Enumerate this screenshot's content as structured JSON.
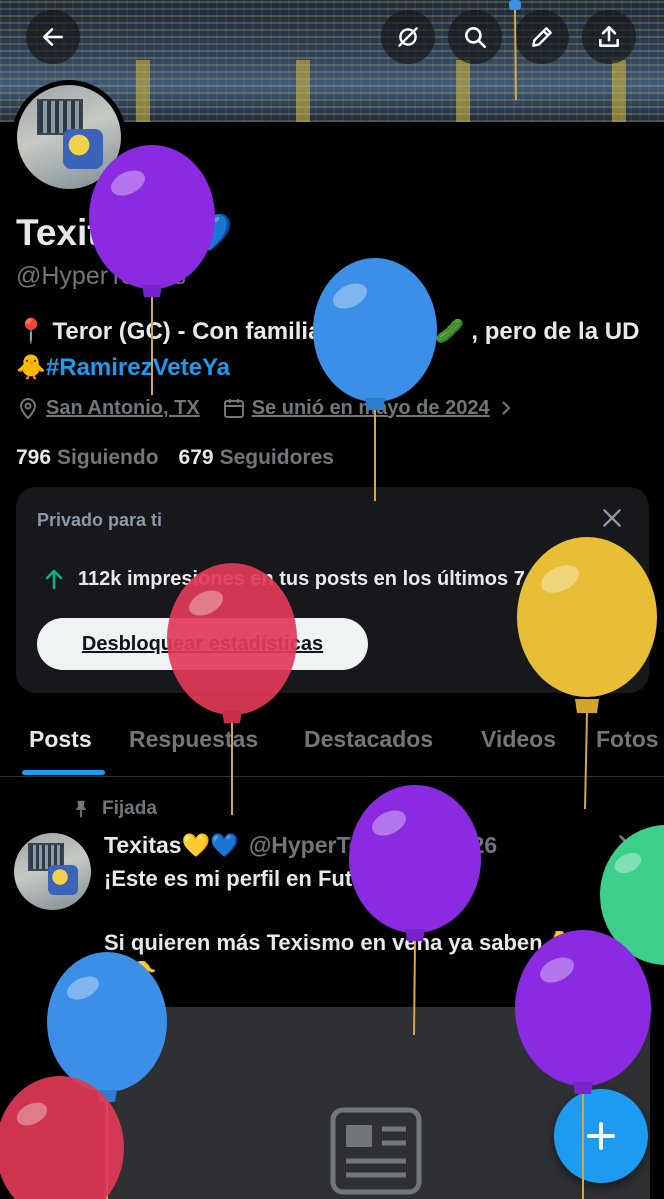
{
  "header": {
    "back_label": "←",
    "icons": [
      "back-icon",
      "tag-off-icon",
      "search-icon",
      "edit-icon",
      "share-icon"
    ]
  },
  "profile": {
    "name": "Texitas",
    "name_emoji": "💜💙",
    "handle": "@HyperTexass",
    "bio_prefix": "📍 Teror (GC) - Con familia pepinera 🥒 , pero de la UD🐥",
    "bio_hashtag": "#RamirezVeteYa",
    "location": "San Antonio, TX",
    "joined": "Se unió en mayo de 2024",
    "following_count": "796",
    "following_label": "Siguiendo",
    "followers_count": "679",
    "followers_label": "Seguidores"
  },
  "private_card": {
    "label": "Privado para ti",
    "stat_text": "112k impresiones en tus posts en los últimos 7 días",
    "button_label": "Desbloquear estadísticas"
  },
  "tabs": [
    {
      "label": "Posts"
    },
    {
      "label": "Respuestas"
    },
    {
      "label": "Destacados"
    },
    {
      "label": "Videos"
    },
    {
      "label": "Fotos"
    }
  ],
  "pinned_post": {
    "pinned_label": "Fijada",
    "author_name": "Texitas💛💙",
    "author_meta": "@HyperTexass · 5/3/26",
    "line1": "¡Este es mi perfil en Futez!",
    "line2": "Si quieren más Texismo en vena ya saben 👇",
    "line3": "👇👇"
  },
  "colors": {
    "accent": "#1d9bf0",
    "balloon_purple": "#8a2be2",
    "balloon_blue": "#3b8fe6",
    "balloon_red": "#e23a57",
    "balloon_yellow": "#e8be36",
    "balloon_green": "#3ccf8a"
  }
}
